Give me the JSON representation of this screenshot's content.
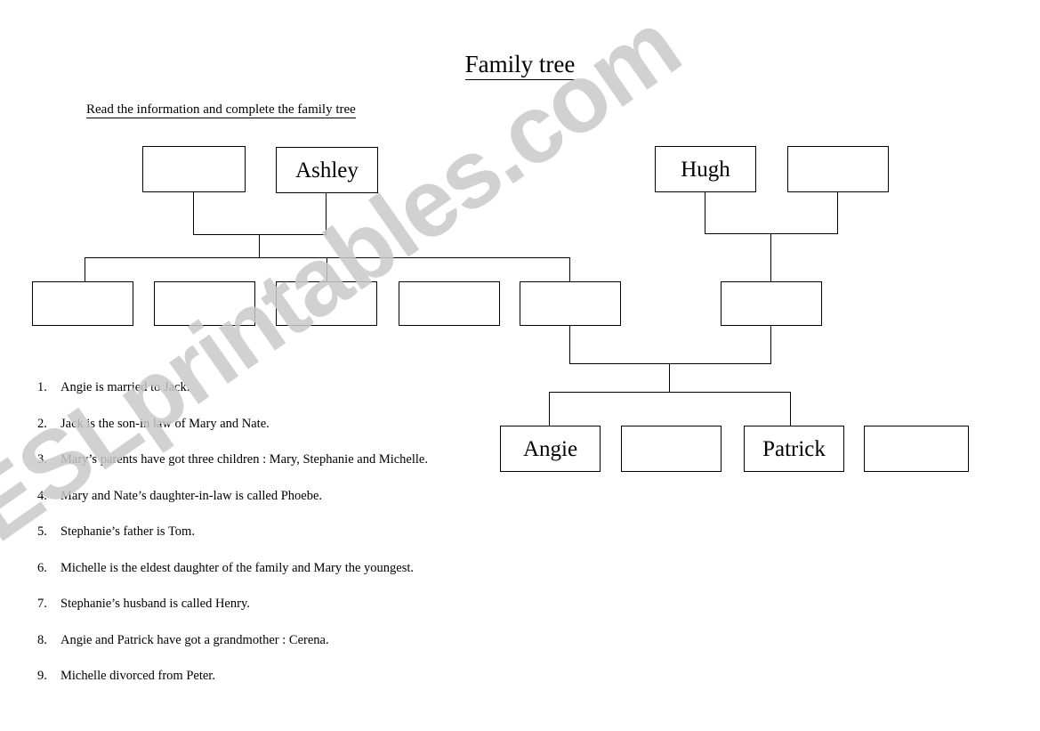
{
  "document": {
    "title": "Family tree",
    "instruction": "Read the information and complete the family tree",
    "watermark": "ESLprintables.com"
  },
  "tree": {
    "generation1": [
      {
        "name": "box-grandfather-left",
        "label": ""
      },
      {
        "name": "box-ashley",
        "label": "Ashley"
      },
      {
        "name": "box-hugh",
        "label": "Hugh"
      },
      {
        "name": "box-grandmother-right",
        "label": ""
      }
    ],
    "generation2": [
      {
        "name": "box-child-1",
        "label": ""
      },
      {
        "name": "box-child-2",
        "label": ""
      },
      {
        "name": "box-child-3",
        "label": ""
      },
      {
        "name": "box-child-4",
        "label": ""
      },
      {
        "name": "box-child-5",
        "label": ""
      },
      {
        "name": "box-child-right",
        "label": ""
      }
    ],
    "generation3": [
      {
        "name": "box-angie",
        "label": "Angie"
      },
      {
        "name": "box-grandchild-2",
        "label": ""
      },
      {
        "name": "box-patrick",
        "label": "Patrick"
      },
      {
        "name": "box-grandchild-4",
        "label": ""
      }
    ]
  },
  "clues": [
    {
      "number": "1.",
      "text": "Angie is married to Jack."
    },
    {
      "number": "2.",
      "text": "Jack is the son-in law of Mary and Nate."
    },
    {
      "number": "3.",
      "text": "Mary’s parents have got three children : Mary, Stephanie and Michelle."
    },
    {
      "number": "4.",
      "text": "Mary and Nate’s daughter-in-law is called Phoebe."
    },
    {
      "number": "5.",
      "text": "Stephanie’s father is Tom."
    },
    {
      "number": "6.",
      "text": "Michelle is the eldest daughter of the family and Mary the youngest."
    },
    {
      "number": "7.",
      "text": "Stephanie’s husband is called Henry."
    },
    {
      "number": "8.",
      "text": "Angie and Patrick have got a grandmother : Cerena."
    },
    {
      "number": "9.",
      "text": "Michelle divorced from Peter."
    }
  ]
}
